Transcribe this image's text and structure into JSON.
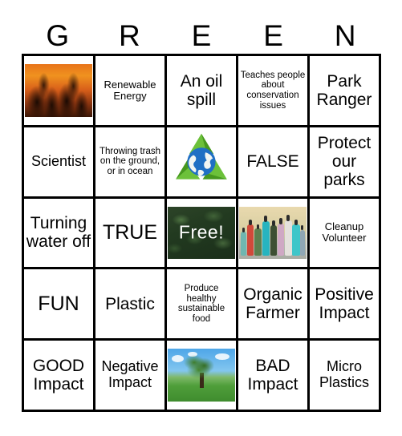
{
  "header": {
    "letters": [
      "G",
      "R",
      "E",
      "E",
      "N"
    ]
  },
  "grid": {
    "columns": 5,
    "rows": 5,
    "cells": [
      {
        "type": "image",
        "image": "forest-fire-photo",
        "label": ""
      },
      {
        "type": "text",
        "text": "Renewable Energy",
        "size": "sm"
      },
      {
        "type": "text",
        "text": "An oil spill",
        "size": "lg"
      },
      {
        "type": "text",
        "text": "Teaches people about conservation issues",
        "size": "xs"
      },
      {
        "type": "text",
        "text": "Park Ranger",
        "size": "lg"
      },
      {
        "type": "text",
        "text": "Scientist",
        "size": "md"
      },
      {
        "type": "text",
        "text": "Throwing trash on the ground, or in ocean",
        "size": "xs"
      },
      {
        "type": "image",
        "image": "recycle-globe-icon",
        "label": ""
      },
      {
        "type": "text",
        "text": "FALSE",
        "size": "lg"
      },
      {
        "type": "text",
        "text": "Protect our parks",
        "size": "lg"
      },
      {
        "type": "text",
        "text": "Turning water off",
        "size": "lg"
      },
      {
        "type": "text",
        "text": "TRUE",
        "size": "xl"
      },
      {
        "type": "image",
        "image": "green-leaves-photo",
        "label": "Free!"
      },
      {
        "type": "image",
        "image": "water-bottles-photo",
        "label": ""
      },
      {
        "type": "text",
        "text": "Cleanup Volunteer",
        "size": "sm"
      },
      {
        "type": "text",
        "text": "FUN",
        "size": "xl"
      },
      {
        "type": "text",
        "text": "Plastic",
        "size": "lg"
      },
      {
        "type": "text",
        "text": "Produce healthy sustainable food",
        "size": "xs"
      },
      {
        "type": "text",
        "text": "Organic Farmer",
        "size": "lg"
      },
      {
        "type": "text",
        "text": "Positive Impact",
        "size": "lg"
      },
      {
        "type": "text",
        "text": "GOOD Impact",
        "size": "lg"
      },
      {
        "type": "text",
        "text": "Negative Impact",
        "size": "md"
      },
      {
        "type": "image",
        "image": "tree-in-field-photo",
        "label": ""
      },
      {
        "type": "text",
        "text": "BAD Impact",
        "size": "lg"
      },
      {
        "type": "text",
        "text": "Micro Plastics",
        "size": "md"
      }
    ]
  },
  "colors": {
    "border": "#000000",
    "background": "#ffffff",
    "text": "#000000",
    "free_label": "#ffffff",
    "recycle_green": "#5cb531",
    "globe_blue": "#1f6fc4",
    "fire_orange": "#e8741a",
    "leaf_dark": "#223a20",
    "sky_blue": "#4ea6e8",
    "grass_green": "#4f9e3a"
  }
}
